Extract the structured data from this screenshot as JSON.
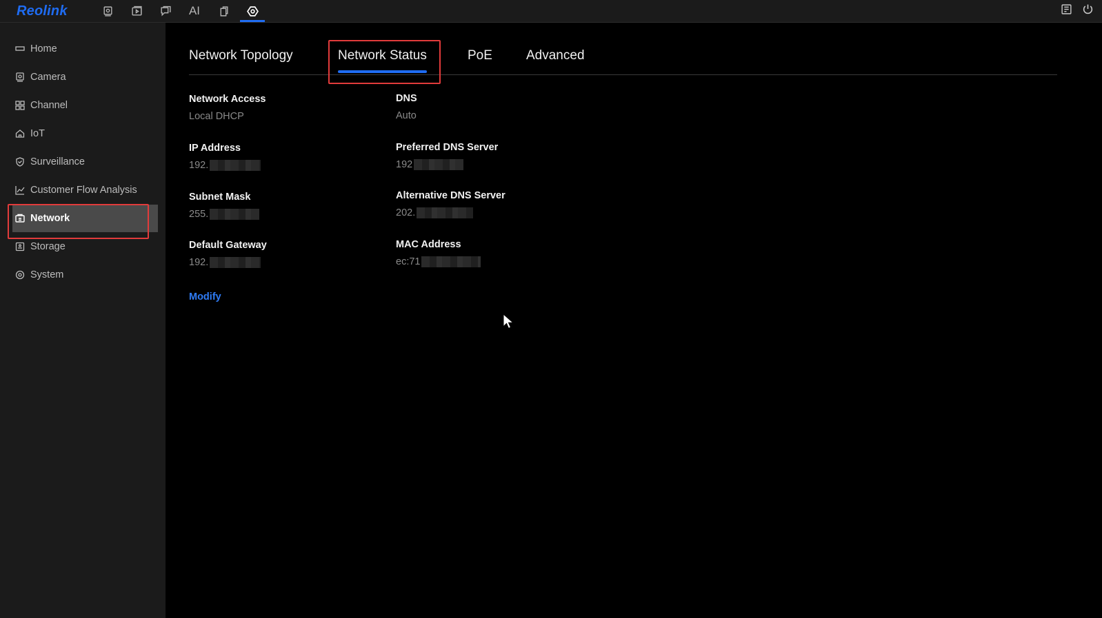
{
  "app": {
    "logo": "Reolink"
  },
  "topnav": {
    "items": [
      {
        "icon": "playback-icon"
      },
      {
        "icon": "video-icon"
      },
      {
        "icon": "message-icon"
      },
      {
        "label": "AI"
      },
      {
        "icon": "device-icon"
      },
      {
        "icon": "settings-icon",
        "active": true
      }
    ],
    "right": [
      "notes-icon",
      "power-icon"
    ]
  },
  "sidebar": {
    "items": [
      {
        "label": "Home",
        "icon": "home-icon"
      },
      {
        "label": "Camera",
        "icon": "camera-icon"
      },
      {
        "label": "Channel",
        "icon": "channel-grid-icon"
      },
      {
        "label": "IoT",
        "icon": "iot-house-icon"
      },
      {
        "label": "Surveillance",
        "icon": "shield-icon"
      },
      {
        "label": "Customer Flow Analysis",
        "icon": "line-chart-icon"
      },
      {
        "label": "Network",
        "icon": "network-icon",
        "active": true
      },
      {
        "label": "Storage",
        "icon": "storage-icon"
      },
      {
        "label": "System",
        "icon": "system-gear-icon"
      }
    ]
  },
  "tabs": [
    {
      "label": "Network Topology"
    },
    {
      "label": "Network Status",
      "active": true
    },
    {
      "label": "PoE"
    },
    {
      "label": "Advanced"
    }
  ],
  "status": {
    "left": [
      {
        "label": "Network Access",
        "value": "Local DHCP"
      },
      {
        "label": "IP Address",
        "value": "192."
      },
      {
        "label": "Subnet Mask",
        "value": "255."
      },
      {
        "label": "Default Gateway",
        "value": "192."
      }
    ],
    "right": [
      {
        "label": "DNS",
        "value": "Auto"
      },
      {
        "label": "Preferred DNS Server",
        "value": "192"
      },
      {
        "label": "Alternative DNS Server",
        "value": "202."
      },
      {
        "label": "MAC Address",
        "value": "ec:71"
      }
    ],
    "modify_label": "Modify"
  },
  "colors": {
    "accent": "#1f6cf2",
    "highlight": "#e23b3b",
    "sidebar_bg": "#1b1b1b",
    "active_item_bg": "#4a4a4a"
  }
}
